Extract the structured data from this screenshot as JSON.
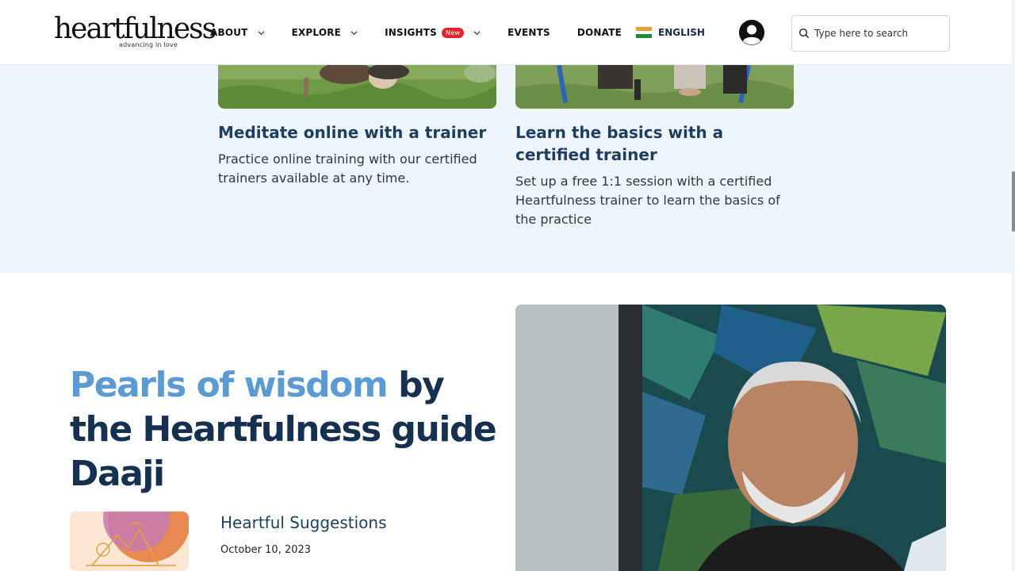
{
  "header": {
    "logo_text": "heartfulness",
    "logo_tagline": "advancing in love",
    "nav": [
      {
        "label": "ABOUT",
        "has_dropdown": true
      },
      {
        "label": "EXPLORE",
        "has_dropdown": true
      },
      {
        "label": "INSIGHTS",
        "has_dropdown": true,
        "badge": "New"
      },
      {
        "label": "EVENTS",
        "has_dropdown": false
      },
      {
        "label": "DONATE",
        "has_dropdown": false
      }
    ],
    "language": "ENGLISH",
    "search_placeholder": "Type here to search"
  },
  "cards": [
    {
      "title": "Meditate online with a trainer",
      "description": "Practice online training with our certified trainers available at any time."
    },
    {
      "title": "Learn the basics with a certified trainer",
      "description": "Set up a free 1:1 session with a certified Heartfulness trainer to learn the basics of the practice"
    }
  ],
  "wisdom": {
    "headline_accent": "Pearls of wisdom",
    "headline_rest": "by the Heartfulness guide Daaji",
    "post_title": "Heartful Suggestions",
    "post_date": "October 10, 2023"
  },
  "colors": {
    "accent": "#5b9bd2",
    "heading": "#16314f",
    "band": "#eef5fd",
    "badge": "#e5242a"
  }
}
